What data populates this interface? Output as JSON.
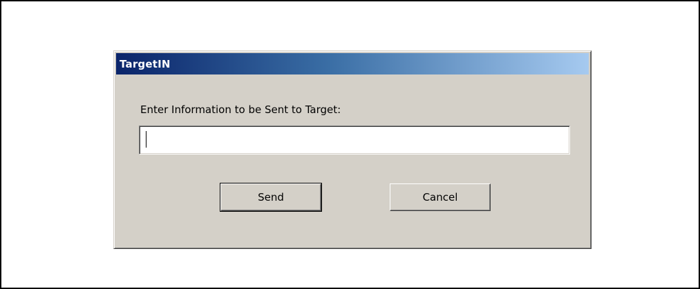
{
  "window": {
    "title": "TargetIN"
  },
  "form": {
    "prompt_label": "Enter Information to be Sent to Target:",
    "input_value": ""
  },
  "buttons": {
    "send_label": "Send",
    "cancel_label": "Cancel"
  },
  "colors": {
    "title_gradient_start": "#0a246a",
    "title_gradient_end": "#a6caf0",
    "dialog_background": "#d4d0c8"
  }
}
